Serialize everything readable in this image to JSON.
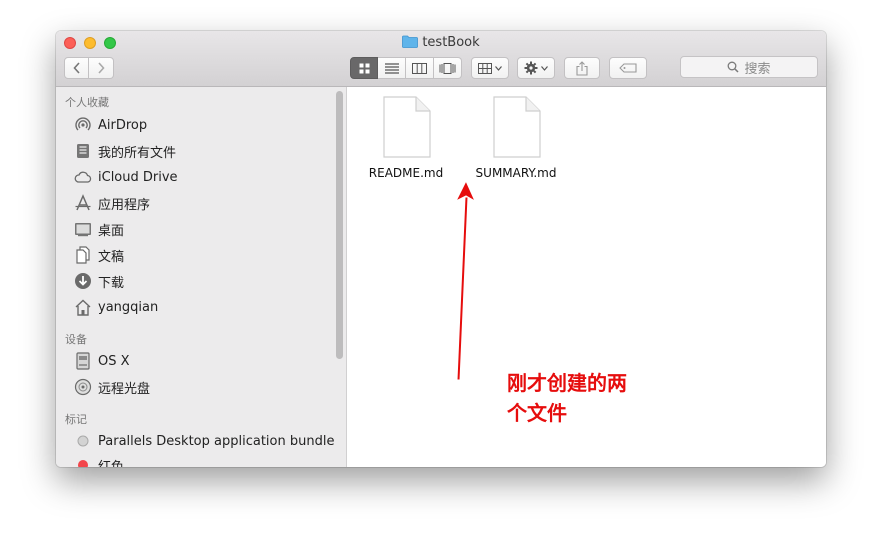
{
  "window": {
    "title": "testBook"
  },
  "toolbar": {
    "search_label": "搜索",
    "icons": [
      "chevron-left-icon",
      "chevron-right-icon",
      "icon-view-icon",
      "list-view-icon",
      "column-view-icon",
      "cover-flow-icon",
      "group-icon",
      "gear-icon",
      "share-icon",
      "tag-icon",
      "search-icon"
    ]
  },
  "sidebar": {
    "sections": [
      {
        "title": "个人收藏",
        "items": [
          {
            "label": "AirDrop",
            "icon": "airdrop-icon"
          },
          {
            "label": "我的所有文件",
            "icon": "all-files-icon"
          },
          {
            "label": "iCloud Drive",
            "icon": "cloud-icon"
          },
          {
            "label": "应用程序",
            "icon": "applications-icon"
          },
          {
            "label": "桌面",
            "icon": "desktop-icon"
          },
          {
            "label": "文稿",
            "icon": "documents-icon"
          },
          {
            "label": "下载",
            "icon": "download-icon"
          },
          {
            "label": "yangqian",
            "icon": "home-icon"
          }
        ]
      },
      {
        "title": "设备",
        "items": [
          {
            "label": "OS X",
            "icon": "disk-icon"
          },
          {
            "label": "远程光盘",
            "icon": "optical-disc-icon"
          }
        ]
      },
      {
        "title": "标记",
        "items": [
          {
            "label": "Parallels Desktop application bundle",
            "icon": "tag-gray-icon"
          },
          {
            "label": "红色",
            "icon": "tag-red-icon"
          }
        ]
      }
    ]
  },
  "files": [
    {
      "name": "README.md",
      "icon": "document-icon"
    },
    {
      "name": "SUMMARY.md",
      "icon": "document-icon"
    }
  ],
  "annotation": {
    "line1": "刚才创建的两",
    "line2": "个文件",
    "color": "#e60d0d"
  },
  "colors": {
    "close": "#fc5f57",
    "minimize": "#fdbc2e",
    "maximize": "#33c748",
    "sidebar_bg": "#ecebec",
    "annotation_red": "#e60d0d"
  }
}
